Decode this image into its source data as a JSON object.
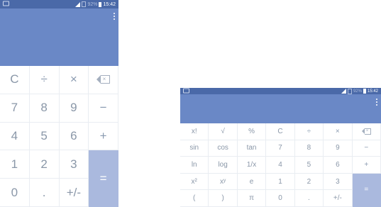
{
  "status_bar": {
    "battery_percent": "92%",
    "time": "15:42",
    "icons": [
      "notification-icon",
      "signal-icon",
      "sim-icon",
      "battery-icon"
    ]
  },
  "display": {
    "value": ""
  },
  "colors": {
    "status_bar": "#4a69a8",
    "display": "#6a88c6",
    "equals_key": "#aab9de",
    "key_text": "#8a97a8"
  },
  "portrait": {
    "keys": [
      [
        "C",
        "÷",
        "×",
        "⌫"
      ],
      [
        "7",
        "8",
        "9",
        "−"
      ],
      [
        "4",
        "5",
        "6",
        "+"
      ],
      [
        "1",
        "2",
        "3",
        "="
      ],
      [
        "0",
        ".",
        "+/-",
        ""
      ]
    ]
  },
  "landscape": {
    "keys": [
      [
        "x!",
        "√",
        "%",
        "C",
        "÷",
        "×",
        "⌫"
      ],
      [
        "sin",
        "cos",
        "tan",
        "7",
        "8",
        "9",
        "−"
      ],
      [
        "ln",
        "log",
        "1/x",
        "4",
        "5",
        "6",
        "+"
      ],
      [
        "x²",
        "xʸ",
        "e",
        "1",
        "2",
        "3",
        "="
      ],
      [
        "(",
        ")",
        "π",
        "0",
        ".",
        "+/-",
        ""
      ]
    ]
  }
}
